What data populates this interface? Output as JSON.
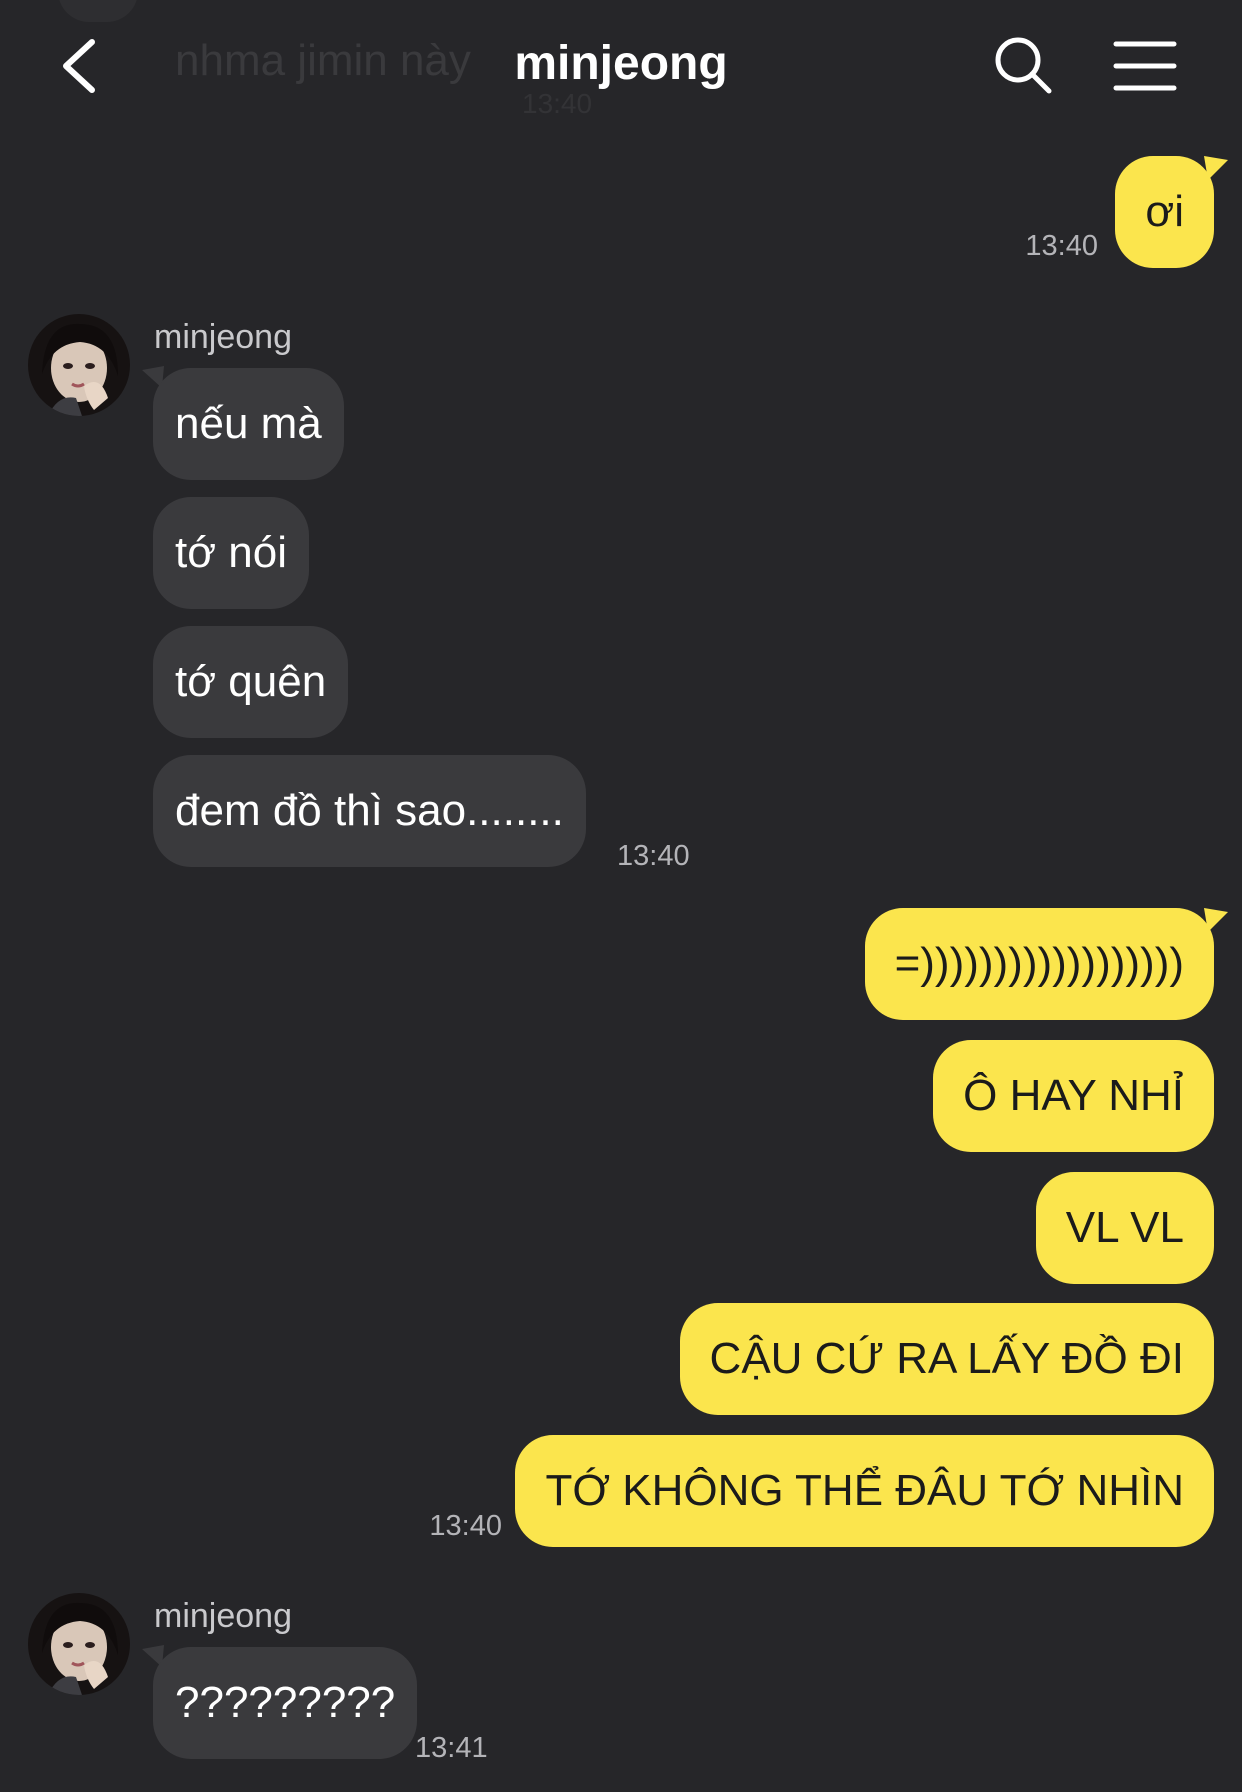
{
  "header": {
    "title": "minjeong",
    "faded_previous_message": "nhma jimin này",
    "faded_previous_time": "13:40"
  },
  "icons": {
    "back": "chevron-left-icon",
    "search": "search-icon",
    "menu": "hamburger-menu-icon"
  },
  "colors": {
    "background": "#262629",
    "incoming_bubble": "#3a3a3d",
    "outgoing_bubble": "#fbe54d",
    "timestamp": "#b4b4b8"
  },
  "messages": {
    "m1": {
      "text": "ơi",
      "time": "13:40"
    },
    "g1": {
      "sender": "minjeong",
      "m1": "nếu mà",
      "m2": "tớ nói",
      "m3": "tớ quên",
      "m4": "đem đồ thì sao........",
      "time": "13:40"
    },
    "g2": {
      "m1": "=))))))))))))))))))",
      "m2": "Ô HAY NHỈ",
      "m3": "VL VL",
      "m4": "CẬU CỨ RA LẤY ĐỒ ĐI",
      "m5": "TỚ KHÔNG THỂ ĐÂU TỚ NHÌN",
      "time": "13:40"
    },
    "g3": {
      "sender": "minjeong",
      "m1": "?????????",
      "time": "13:41"
    }
  }
}
